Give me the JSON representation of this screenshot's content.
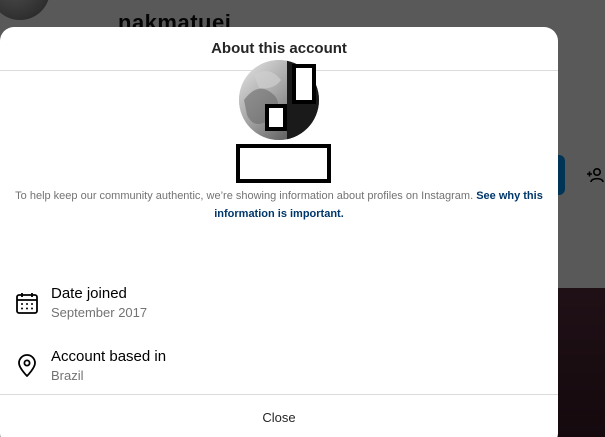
{
  "background": {
    "username": "nakmatuei"
  },
  "modal": {
    "title": "About this account",
    "info_text": "To help keep our community authentic, we’re showing information about profiles on Instagram.",
    "info_link": "See why this information is important.",
    "rows": [
      {
        "icon": "calendar-icon",
        "title": "Date joined",
        "value": "September 2017"
      },
      {
        "icon": "location-pin-icon",
        "title": "Account based in",
        "value": "Brazil"
      }
    ],
    "close_label": "Close"
  },
  "colors": {
    "link": "#00376b",
    "muted_text": "#737373",
    "divider": "#dbdbdb",
    "follow_button": "#0095f6"
  }
}
